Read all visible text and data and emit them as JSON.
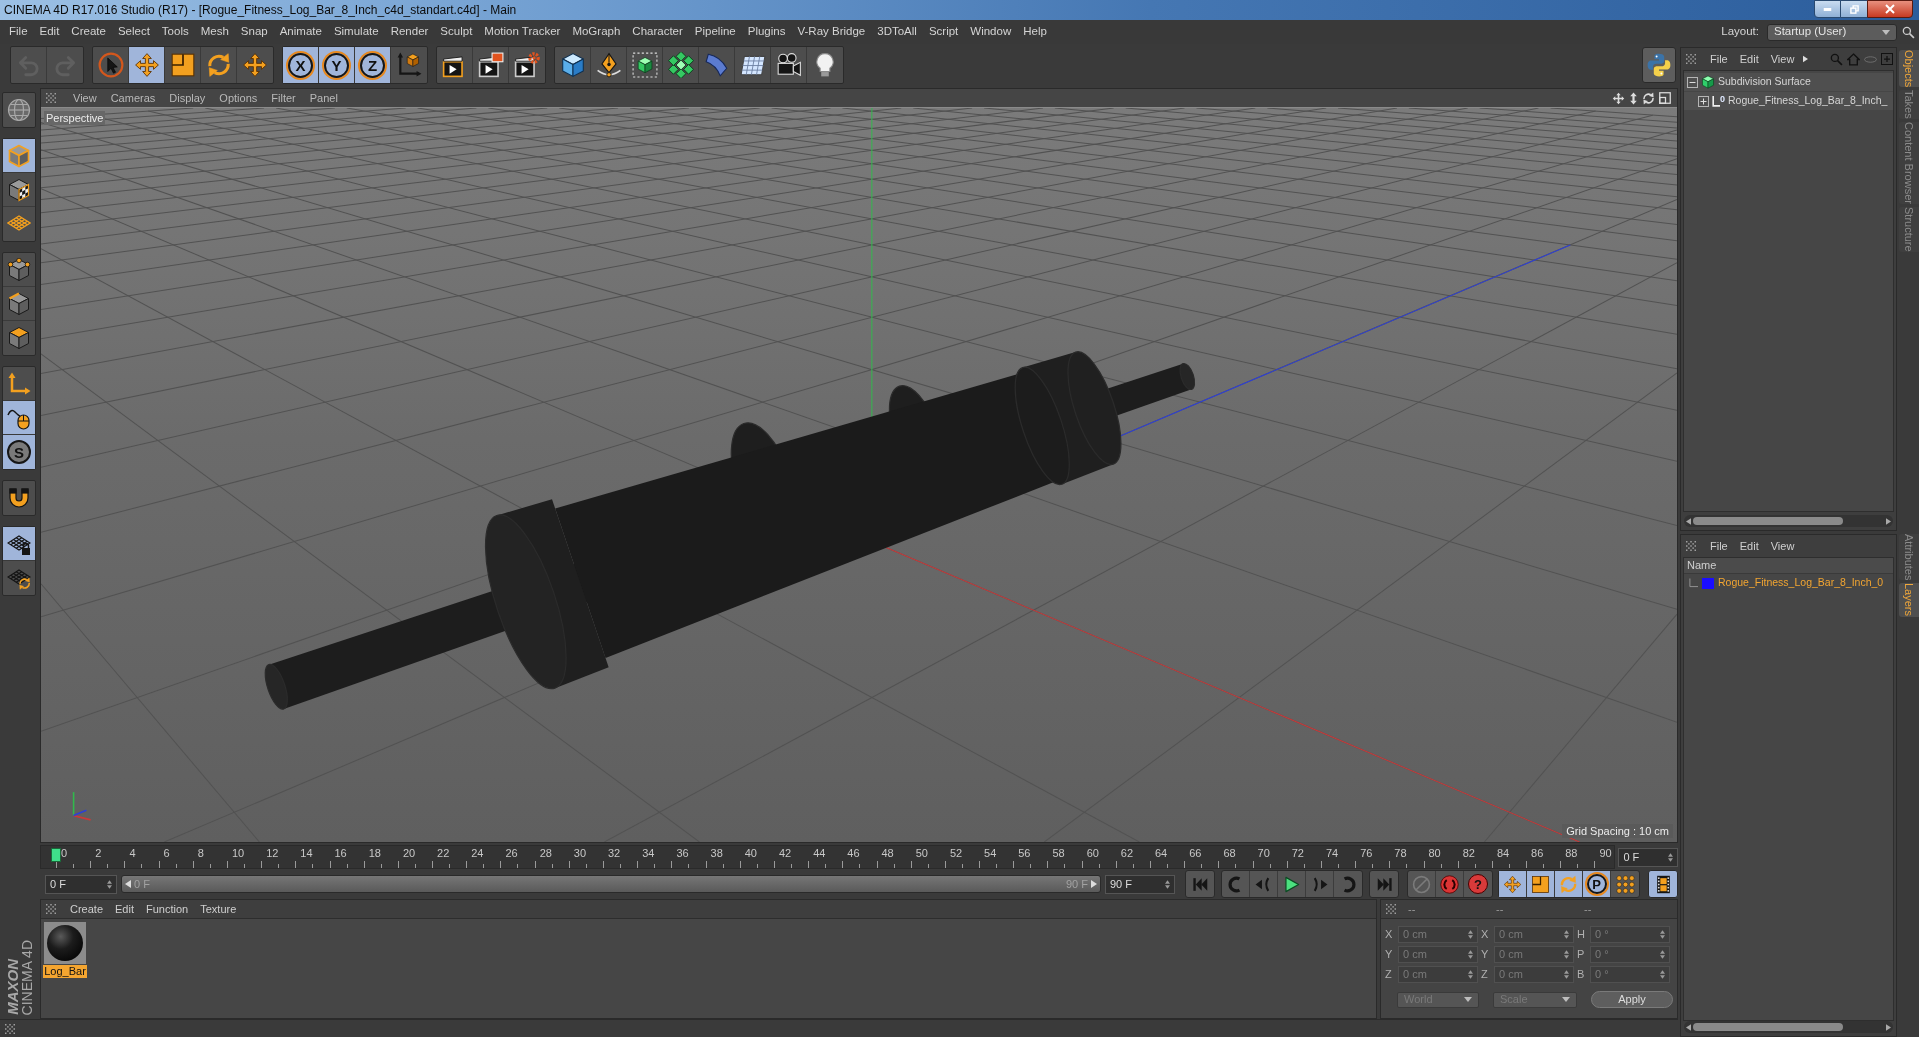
{
  "window": {
    "title": "CINEMA 4D R17.016 Studio (R17) - [Rogue_Fitness_Log_Bar_8_Inch_c4d_standart.c4d] - Main"
  },
  "menu_bar": {
    "items": [
      "File",
      "Edit",
      "Create",
      "Select",
      "Tools",
      "Mesh",
      "Snap",
      "Animate",
      "Simulate",
      "Render",
      "Sculpt",
      "Motion Tracker",
      "MoGraph",
      "Character",
      "Pipeline",
      "Plugins",
      "V-Ray Bridge",
      "3DToAll",
      "Script",
      "Window",
      "Help"
    ],
    "layout_label": "Layout:",
    "layout_value": "Startup (User)"
  },
  "toolbar": {
    "groups": [
      {
        "tools": [
          {
            "kind": "undo",
            "selected": false,
            "disabled": true
          },
          {
            "kind": "redo",
            "selected": false,
            "disabled": true
          }
        ]
      },
      {
        "tools": [
          {
            "kind": "live-select",
            "selected": false
          },
          {
            "kind": "move",
            "selected": true
          },
          {
            "kind": "scale",
            "selected": false
          },
          {
            "kind": "rotate",
            "selected": false
          },
          {
            "kind": "recent-move",
            "selected": false
          }
        ]
      },
      {
        "tools": [
          {
            "kind": "axis-lock",
            "label": "X",
            "selected": true
          },
          {
            "kind": "axis-lock",
            "label": "Y",
            "selected": true
          },
          {
            "kind": "axis-lock",
            "label": "Z",
            "selected": true
          },
          {
            "kind": "coordinate-system",
            "selected": false
          }
        ]
      },
      {
        "tools": [
          {
            "kind": "render-view",
            "selected": false
          },
          {
            "kind": "render-picture",
            "selected": false
          },
          {
            "kind": "render-settings",
            "selected": false
          }
        ]
      },
      {
        "tools": [
          {
            "kind": "cube",
            "selected": false
          },
          {
            "kind": "pen",
            "selected": false
          },
          {
            "kind": "subdivision",
            "selected": false
          },
          {
            "kind": "cloner",
            "selected": false
          },
          {
            "kind": "deformer",
            "selected": false
          },
          {
            "kind": "floor",
            "selected": false
          },
          {
            "kind": "camera",
            "selected": false
          },
          {
            "kind": "light",
            "selected": false
          }
        ]
      }
    ]
  },
  "left_toolbar": {
    "groups": [
      {
        "tools": [
          {
            "kind": "make-editable",
            "selected": false
          }
        ]
      },
      {
        "tools": [
          {
            "kind": "model",
            "selected": true
          },
          {
            "kind": "texture",
            "selected": false
          },
          {
            "kind": "workplane",
            "selected": false
          }
        ]
      },
      {
        "tools": [
          {
            "kind": "points",
            "selected": false
          },
          {
            "kind": "edges",
            "selected": false
          },
          {
            "kind": "polygons",
            "selected": false
          }
        ]
      },
      {
        "tools": [
          {
            "kind": "axis",
            "selected": false
          },
          {
            "kind": "tweak",
            "selected": true
          },
          {
            "kind": "snap",
            "label": "S",
            "selected": true
          }
        ]
      },
      {
        "tools": [
          {
            "kind": "magnet",
            "selected": false
          }
        ]
      },
      {
        "tools": [
          {
            "kind": "workplane-lock",
            "selected": true
          },
          {
            "kind": "workplane-rotate",
            "selected": false
          }
        ]
      }
    ]
  },
  "viewport": {
    "menu": [
      "View",
      "Cameras",
      "Display",
      "Options",
      "Filter",
      "Panel"
    ],
    "camera_label": "Perspective",
    "grid_spacing": "Grid Spacing : 10 cm"
  },
  "timeline": {
    "ticks": [
      "0",
      "2",
      "4",
      "6",
      "8",
      "10",
      "12",
      "14",
      "16",
      "18",
      "20",
      "22",
      "24",
      "26",
      "28",
      "30",
      "32",
      "34",
      "36",
      "38",
      "40",
      "42",
      "44",
      "46",
      "48",
      "50",
      "52",
      "54",
      "56",
      "58",
      "60",
      "62",
      "64",
      "66",
      "68",
      "70",
      "72",
      "74",
      "76",
      "78",
      "80",
      "82",
      "84",
      "86",
      "88",
      "90"
    ],
    "playhead": {
      "level": 0
    },
    "current_frame": "0 F"
  },
  "transport": {
    "start_frame": "0 F",
    "range_start": "0 F",
    "range_end": "90 F",
    "end_frame": "90 F",
    "groups": [
      {
        "buttons": [
          {
            "kind": "go-to-start"
          }
        ]
      },
      {
        "buttons": [
          {
            "kind": "previous-key"
          },
          {
            "kind": "previous-frame"
          },
          {
            "kind": "play"
          },
          {
            "kind": "next-frame"
          },
          {
            "kind": "next-key"
          }
        ]
      },
      {
        "buttons": [
          {
            "kind": "go-to-end"
          }
        ]
      },
      {
        "buttons": [
          {
            "kind": "record-motion",
            "disabled": true
          },
          {
            "kind": "autokey",
            "disabled": false
          },
          {
            "kind": "keyframe-selection",
            "label": "?",
            "disabled": false
          }
        ]
      },
      {
        "buttons": [
          {
            "kind": "position-key",
            "selected": true
          },
          {
            "kind": "scale-key",
            "selected": true
          },
          {
            "kind": "rotation-key",
            "selected": true
          },
          {
            "kind": "parameter-key",
            "label": "P",
            "selected": true
          },
          {
            "kind": "point-level",
            "selected": false
          }
        ]
      },
      {
        "buttons": [
          {
            "kind": "timeline",
            "selected": true
          }
        ]
      }
    ]
  },
  "materials": {
    "menu": [
      "Create",
      "Edit",
      "Function",
      "Texture"
    ],
    "items": [
      {
        "name": "Log_Bar",
        "selected": true
      }
    ]
  },
  "coordinates": {
    "headers": [
      "--",
      "--",
      "--"
    ],
    "disabled": true,
    "rows": [
      {
        "fields": [
          {
            "label": "X",
            "value": "0 cm"
          },
          {
            "label": "X",
            "value": "0 cm"
          },
          {
            "label": "H",
            "value": "0 °"
          }
        ]
      },
      {
        "fields": [
          {
            "label": "Y",
            "value": "0 cm"
          },
          {
            "label": "Y",
            "value": "0 cm"
          },
          {
            "label": "P",
            "value": "0 °"
          }
        ]
      },
      {
        "fields": [
          {
            "label": "Z",
            "value": "0 cm"
          },
          {
            "label": "Z",
            "value": "0 cm"
          },
          {
            "label": "B",
            "value": "0 °"
          }
        ]
      }
    ],
    "mode": "World",
    "transform": "Scale",
    "apply": "Apply"
  },
  "objects_panel": {
    "menu": [
      "File",
      "Edit",
      "View"
    ],
    "tree": [
      {
        "name": "Subdivision Surface",
        "kind": "subdivision",
        "expanded": true,
        "children": [
          {
            "name": "Rogue_Fitness_Log_Bar_8_Inch_",
            "kind": "null",
            "icon_text": "0",
            "expanded": false
          }
        ]
      }
    ]
  },
  "layers_panel": {
    "menu": [
      "File",
      "Edit",
      "View"
    ],
    "column": "Name",
    "items": [
      {
        "name": "Rogue_Fitness_Log_Bar_8_Inch_0",
        "color": "#1a0dff"
      }
    ]
  },
  "side_tabs": {
    "top": [
      {
        "label": "Objects",
        "selected": true
      },
      {
        "label": "Takes",
        "selected": false
      },
      {
        "label": "Content Browser",
        "selected": false
      },
      {
        "label": "Structure",
        "selected": false
      }
    ],
    "bottom": [
      {
        "label": "Attributes",
        "selected": false
      },
      {
        "label": "Layers",
        "selected": true
      }
    ]
  },
  "brand": {
    "line_1": "MAXON",
    "line_2": "CINEMA 4D"
  }
}
